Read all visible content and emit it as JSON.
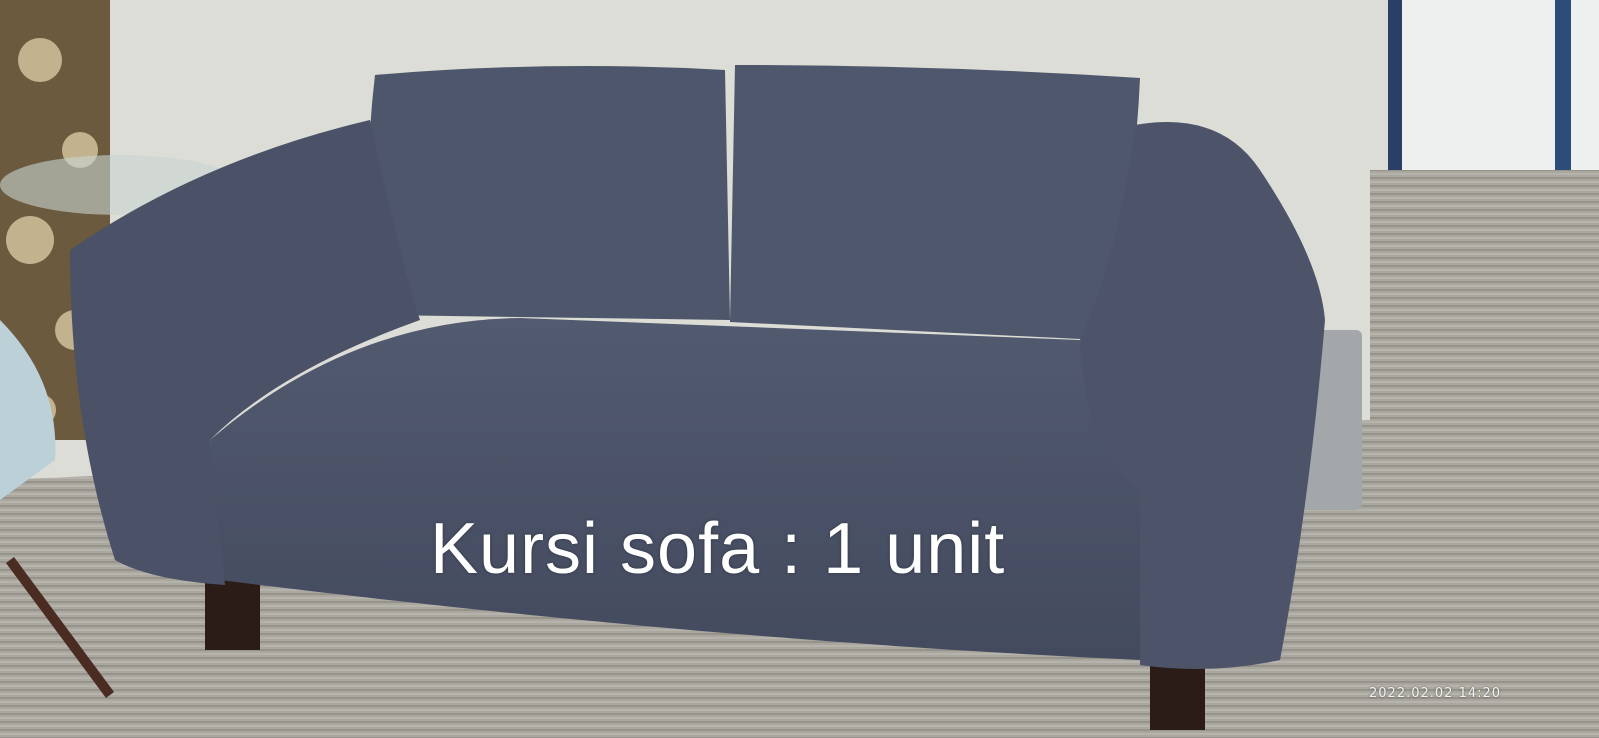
{
  "photo": {
    "caption": "Kursi sofa : 1 unit",
    "timestamp": "2022.02.02 14:20",
    "colors": {
      "wall": "#dcddd6",
      "sofa": "#4a5166",
      "carpet": "#a9a69f",
      "curtain": "#6b5a3e"
    }
  }
}
